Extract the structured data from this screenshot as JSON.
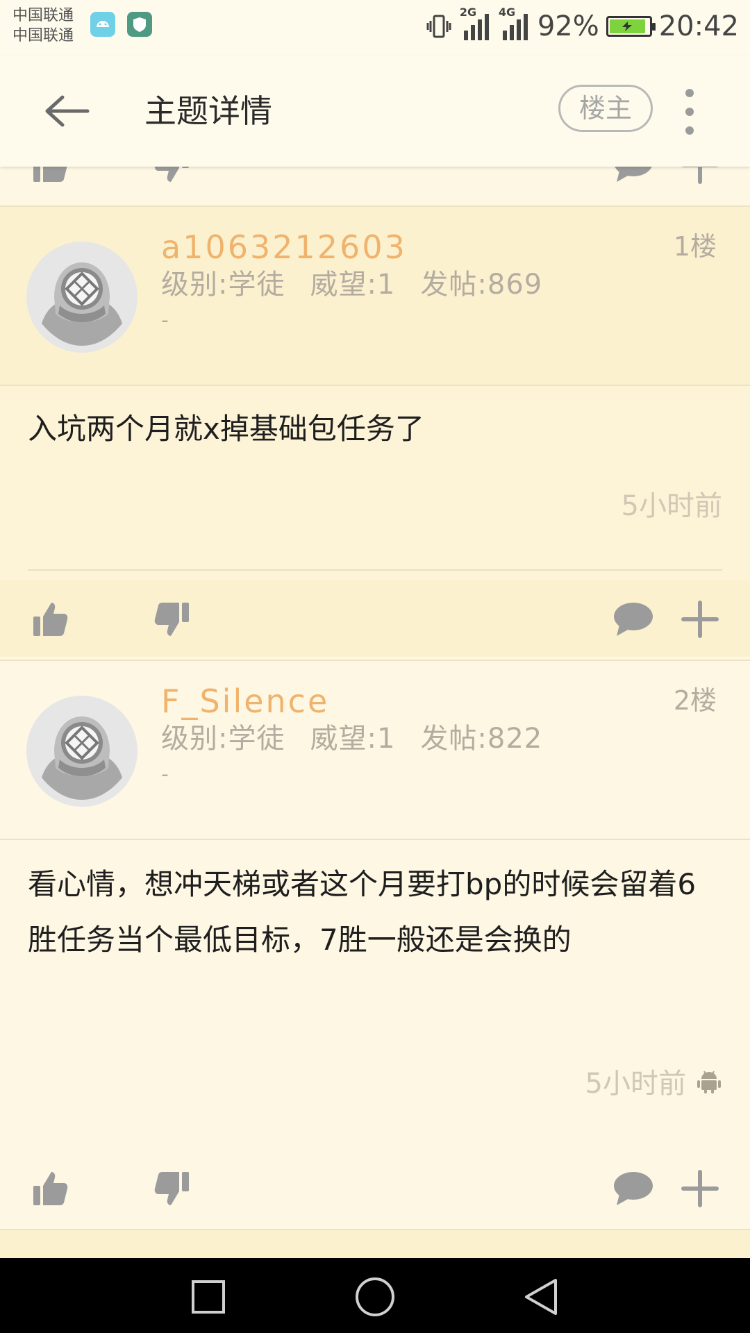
{
  "status_bar": {
    "carrier_1": "中国联通",
    "carrier_2": "中国联通",
    "network_1": "2G",
    "network_2": "4G",
    "battery": "92%",
    "time": "20:42",
    "battery_color": "#7ed23d"
  },
  "app_bar": {
    "title": "主题详情",
    "op_filter_label": "楼主"
  },
  "posts": [
    {
      "username": "a1063212603",
      "level": "级别:学徒",
      "prestige": "威望:1",
      "post_count": "发帖:869",
      "signature": "-",
      "floor": "1楼",
      "body": "入坑两个月就x掉基础包任务了",
      "time": "5小时前",
      "client_icon": "none"
    },
    {
      "username": "F_Silence",
      "level": "级别:学徒",
      "prestige": "威望:1",
      "post_count": "发帖:822",
      "signature": "-",
      "floor": "2楼",
      "body": "看心情，想冲天梯或者这个月要打bp的时候会留着6胜任务当个最低目标，7胜一般还是会换的",
      "time": "5小时前",
      "client_icon": "android-icon"
    }
  ],
  "colors": {
    "accent_username": "#f0b36e",
    "post_bg_highlight": "#fcf1cf",
    "post_bg": "#fdf7e3",
    "icon_gray": "#9b9b9b"
  }
}
